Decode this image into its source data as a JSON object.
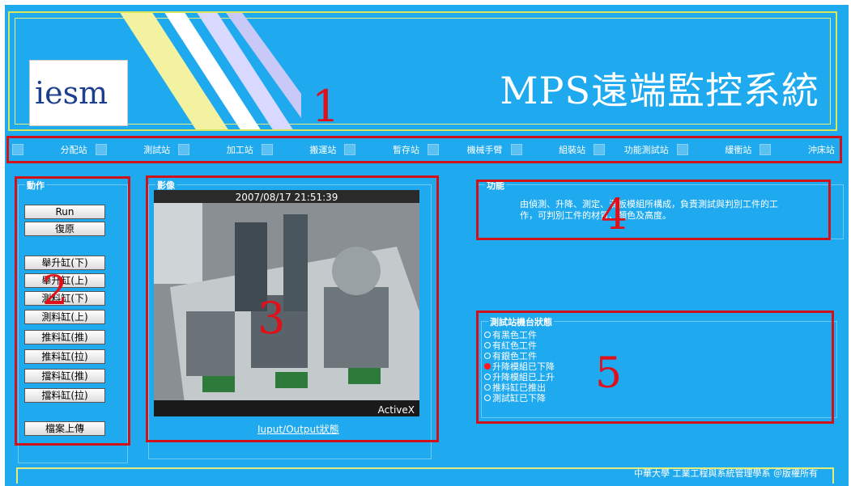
{
  "header": {
    "logo_text": "iesm",
    "title": "MPS遠端監控系統"
  },
  "nav": {
    "items": [
      "分配站",
      "測試站",
      "加工站",
      "搬運站",
      "暫存站",
      "機械手臂",
      "組裝站",
      "功能測試站",
      "緩衝站",
      "沖床站"
    ]
  },
  "operations": {
    "legend": "動作",
    "buttons": [
      "Run",
      "復原",
      "舉升缸(下)",
      "舉升缸(上)",
      "測料缸(下)",
      "測料缸(上)",
      "推料缸(推)",
      "推料缸(拉)",
      "擋料缸(推)",
      "擋料缸(拉)",
      "檔案上傳"
    ]
  },
  "image_panel": {
    "legend": "影像",
    "timestamp": "2007/08/17 21:51:39",
    "activex_label": "ActiveX",
    "io_link": "Iuput/Output狀態"
  },
  "function_panel": {
    "legend": "功能",
    "description": "由偵測、升降、測定、滑板模組所構成，負責測試與判別工件的工作，可判別工件的材質、顏色及高度。"
  },
  "status_panel": {
    "legend": "測試站機台狀態",
    "items": [
      {
        "label": "有黑色工件",
        "active": false
      },
      {
        "label": "有紅色工件",
        "active": false
      },
      {
        "label": "有銀色工件",
        "active": false
      },
      {
        "label": "升降模組已下降",
        "active": true
      },
      {
        "label": "升降模組已上升",
        "active": false
      },
      {
        "label": "推料缸已推出",
        "active": false
      },
      {
        "label": "測試缸已下降",
        "active": false
      }
    ]
  },
  "markers": [
    "1",
    "2",
    "3",
    "4",
    "5"
  ],
  "footer": {
    "text": "中華大學 工業工程與系統管理學系 ＠版權所有"
  },
  "colors": {
    "background": "#1fa9ef",
    "highlight": "#d0121a",
    "accent_yellow": "#e6ec7a"
  }
}
